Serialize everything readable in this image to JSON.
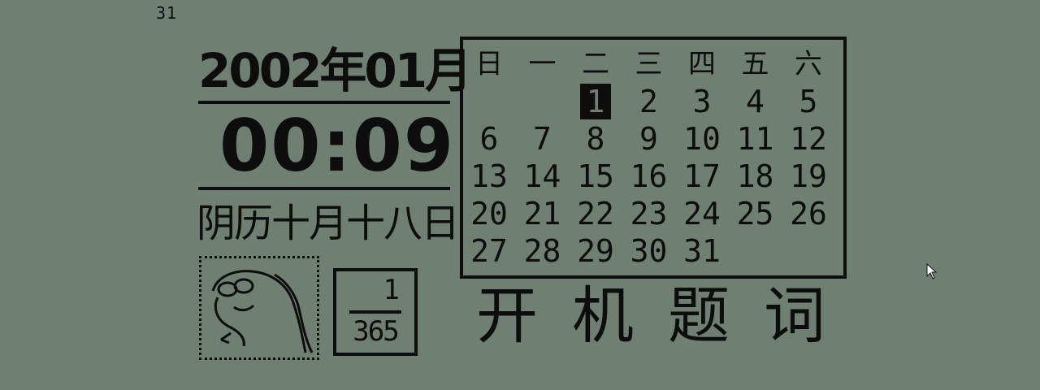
{
  "corner_text": "31",
  "year_month": "2002年01月",
  "time": "00:09",
  "lunar_date": "阴历十月十八日",
  "calendar": {
    "weekdays": [
      "日",
      "一",
      "二",
      "三",
      "四",
      "五",
      "六"
    ],
    "first_weekday": 2,
    "days_in_month": 31,
    "today": 1
  },
  "day_of_year": {
    "day": "1",
    "total": "365"
  },
  "greeting": "开机题词",
  "icons": [
    "snake-icon",
    "mouse-cursor-icon"
  ]
}
